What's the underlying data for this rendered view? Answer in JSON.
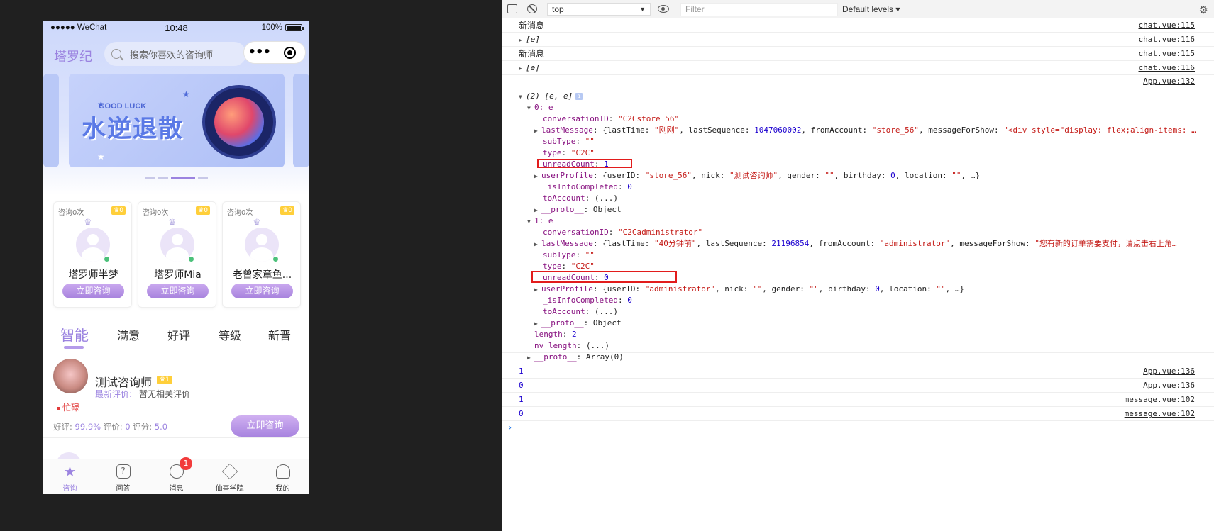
{
  "phone": {
    "status": {
      "carrier": "●●●●● WeChat",
      "time": "10:48",
      "battery": "100%"
    },
    "brand": "塔罗纪",
    "search_placeholder": "搜索你喜欢的咨询师",
    "capsule_more": "•••",
    "banner": {
      "tag": "GOOD LUCK",
      "art_text": "水逆退散"
    },
    "featured": [
      {
        "count": "咨询0次",
        "level": "0",
        "name": "塔罗师半梦",
        "button": "立即咨询"
      },
      {
        "count": "咨询0次",
        "level": "0",
        "name": "塔罗师Mia",
        "button": "立即咨询"
      },
      {
        "count": "咨询0次",
        "level": "0",
        "name": "老曾家章鱼...",
        "button": "立即咨询"
      }
    ],
    "tabs": [
      "智能",
      "满意",
      "好评",
      "等级",
      "新晋"
    ],
    "advisor": {
      "name": "测试咨询师",
      "level": "1",
      "review_label": "最新评价:",
      "review_text": "暂无相关评价",
      "status": "忙碌",
      "stats": {
        "good_label": "好评:",
        "good_value": "99.9%",
        "eval_label": "评价:",
        "eval_value": "0",
        "score_label": "评分:",
        "score_value": "5.0"
      },
      "button": "立即咨询"
    },
    "tabbar": [
      {
        "label": "咨询",
        "icon": "star-icon"
      },
      {
        "label": "问答",
        "icon": "question-icon"
      },
      {
        "label": "消息",
        "icon": "chat-icon",
        "badge": "1"
      },
      {
        "label": "仙喜学院",
        "icon": "graduation-cap-icon"
      },
      {
        "label": "我的",
        "icon": "user-icon"
      }
    ]
  },
  "devtools": {
    "context": "top",
    "filter_placeholder": "Filter",
    "levels": "Default levels ▾",
    "logs": [
      {
        "text": "新消息",
        "src": "chat.vue:115"
      },
      {
        "text": "[e]",
        "src": "chat.vue:116"
      },
      {
        "text": "新消息",
        "src": "chat.vue:115"
      },
      {
        "text": "[e]",
        "src": "chat.vue:116"
      }
    ],
    "object_src": "App.vue:132",
    "object_header": "(2) [e, e]",
    "items": [
      {
        "index": "0: e",
        "conversationID": "\"C2Cstore_56\"",
        "lastMessage_lastTime": "\"刚刚\"",
        "lastMessage_seq": "1047060002",
        "lastMessage_from": "\"store_56\"",
        "lastMessage_show": "\"<div style=\"display: flex;align-items: …",
        "subType": "\"\"",
        "type": "\"C2C\"",
        "unreadCount": "1",
        "up_userID": "\"store_56\"",
        "up_nick": "\"测试咨询师\"",
        "up_gender": "\"\"",
        "up_birthday": "0",
        "up_location": "\"\"",
        "isInfoCompleted": "0",
        "toAccount": "(...)",
        "proto": "Object"
      },
      {
        "index": "1: e",
        "conversationID": "\"C2Cadministrator\"",
        "lastMessage_lastTime": "\"40分钟前\"",
        "lastMessage_seq": "21196854",
        "lastMessage_from": "\"administrator\"",
        "lastMessage_show": "\"您有新的订单需要支付，请点击右上角…",
        "subType": "\"\"",
        "type": "\"C2C\"",
        "unreadCount": "0",
        "up_userID": "\"administrator\"",
        "up_nick": "\"\"",
        "up_gender": "\"\"",
        "up_birthday": "0",
        "up_location": "\"\"",
        "isInfoCompleted": "0",
        "toAccount": "(...)",
        "proto": "Object"
      }
    ],
    "length": "2",
    "nv_length": "(...)",
    "array_proto": "Array(0)",
    "tail_logs": [
      {
        "text": "1",
        "src": "App.vue:136"
      },
      {
        "text": "0",
        "src": "App.vue:136"
      },
      {
        "text": "1",
        "src": "message.vue:102"
      },
      {
        "text": "0",
        "src": "message.vue:102"
      }
    ],
    "prompt": "›"
  }
}
